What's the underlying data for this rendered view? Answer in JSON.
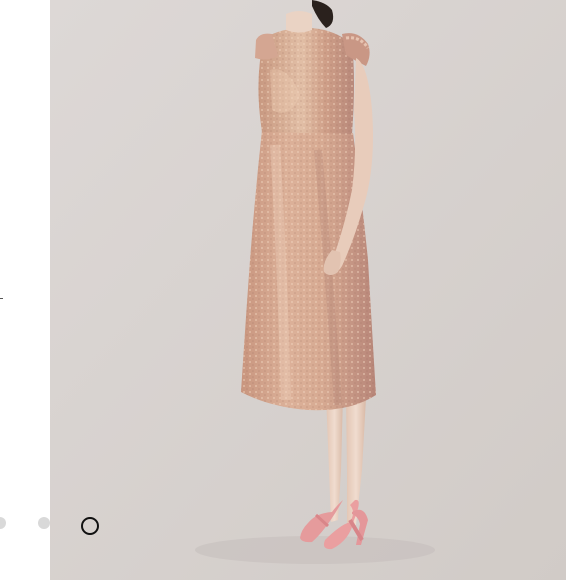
{
  "product_photo": {
    "icon": "dress-photo",
    "colors": {
      "background": "#d9d4d1",
      "dress": "#c99a86",
      "dress_highlight": "#e3c0a8",
      "skin": "#ead2c2",
      "hair": "#2a211d",
      "shoes": "#e79a9b"
    }
  },
  "carousel": {
    "slide_count": 3,
    "active_index": 3,
    "dot_colors": {
      "inactive": "#d9d9d9",
      "active_border": "#111111"
    }
  }
}
